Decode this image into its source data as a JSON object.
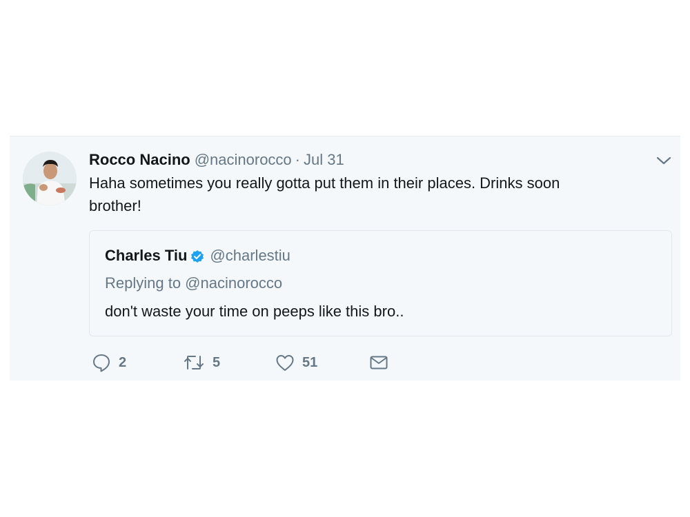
{
  "tweet": {
    "author_name": "Rocco Nacino",
    "author_handle": "@nacinorocco",
    "separator": "·",
    "timestamp": "Jul 31",
    "text": "Haha sometimes you really gotta put them in their places. Drinks soon brother!",
    "avatar_icon": "avatar-photo",
    "menu_icon": "chevron-down-icon"
  },
  "quote": {
    "author_name": "Charles Tiu",
    "verified_icon": "verified-badge-icon",
    "author_handle": "@charlestiu",
    "replying_to": "Replying to @nacinorocco",
    "text": "don't waste your time on peeps like this bro.."
  },
  "actions": {
    "reply": {
      "icon": "reply-icon",
      "count": "2"
    },
    "retweet": {
      "icon": "retweet-icon",
      "count": "5"
    },
    "like": {
      "icon": "heart-icon",
      "count": "51"
    },
    "dm": {
      "icon": "envelope-icon"
    }
  },
  "colors": {
    "card_background": "#f5f8fa",
    "primary_text": "#14171a",
    "secondary_text": "#657786",
    "verified_blue": "#1da1f2",
    "border": "#e1e8ed"
  }
}
